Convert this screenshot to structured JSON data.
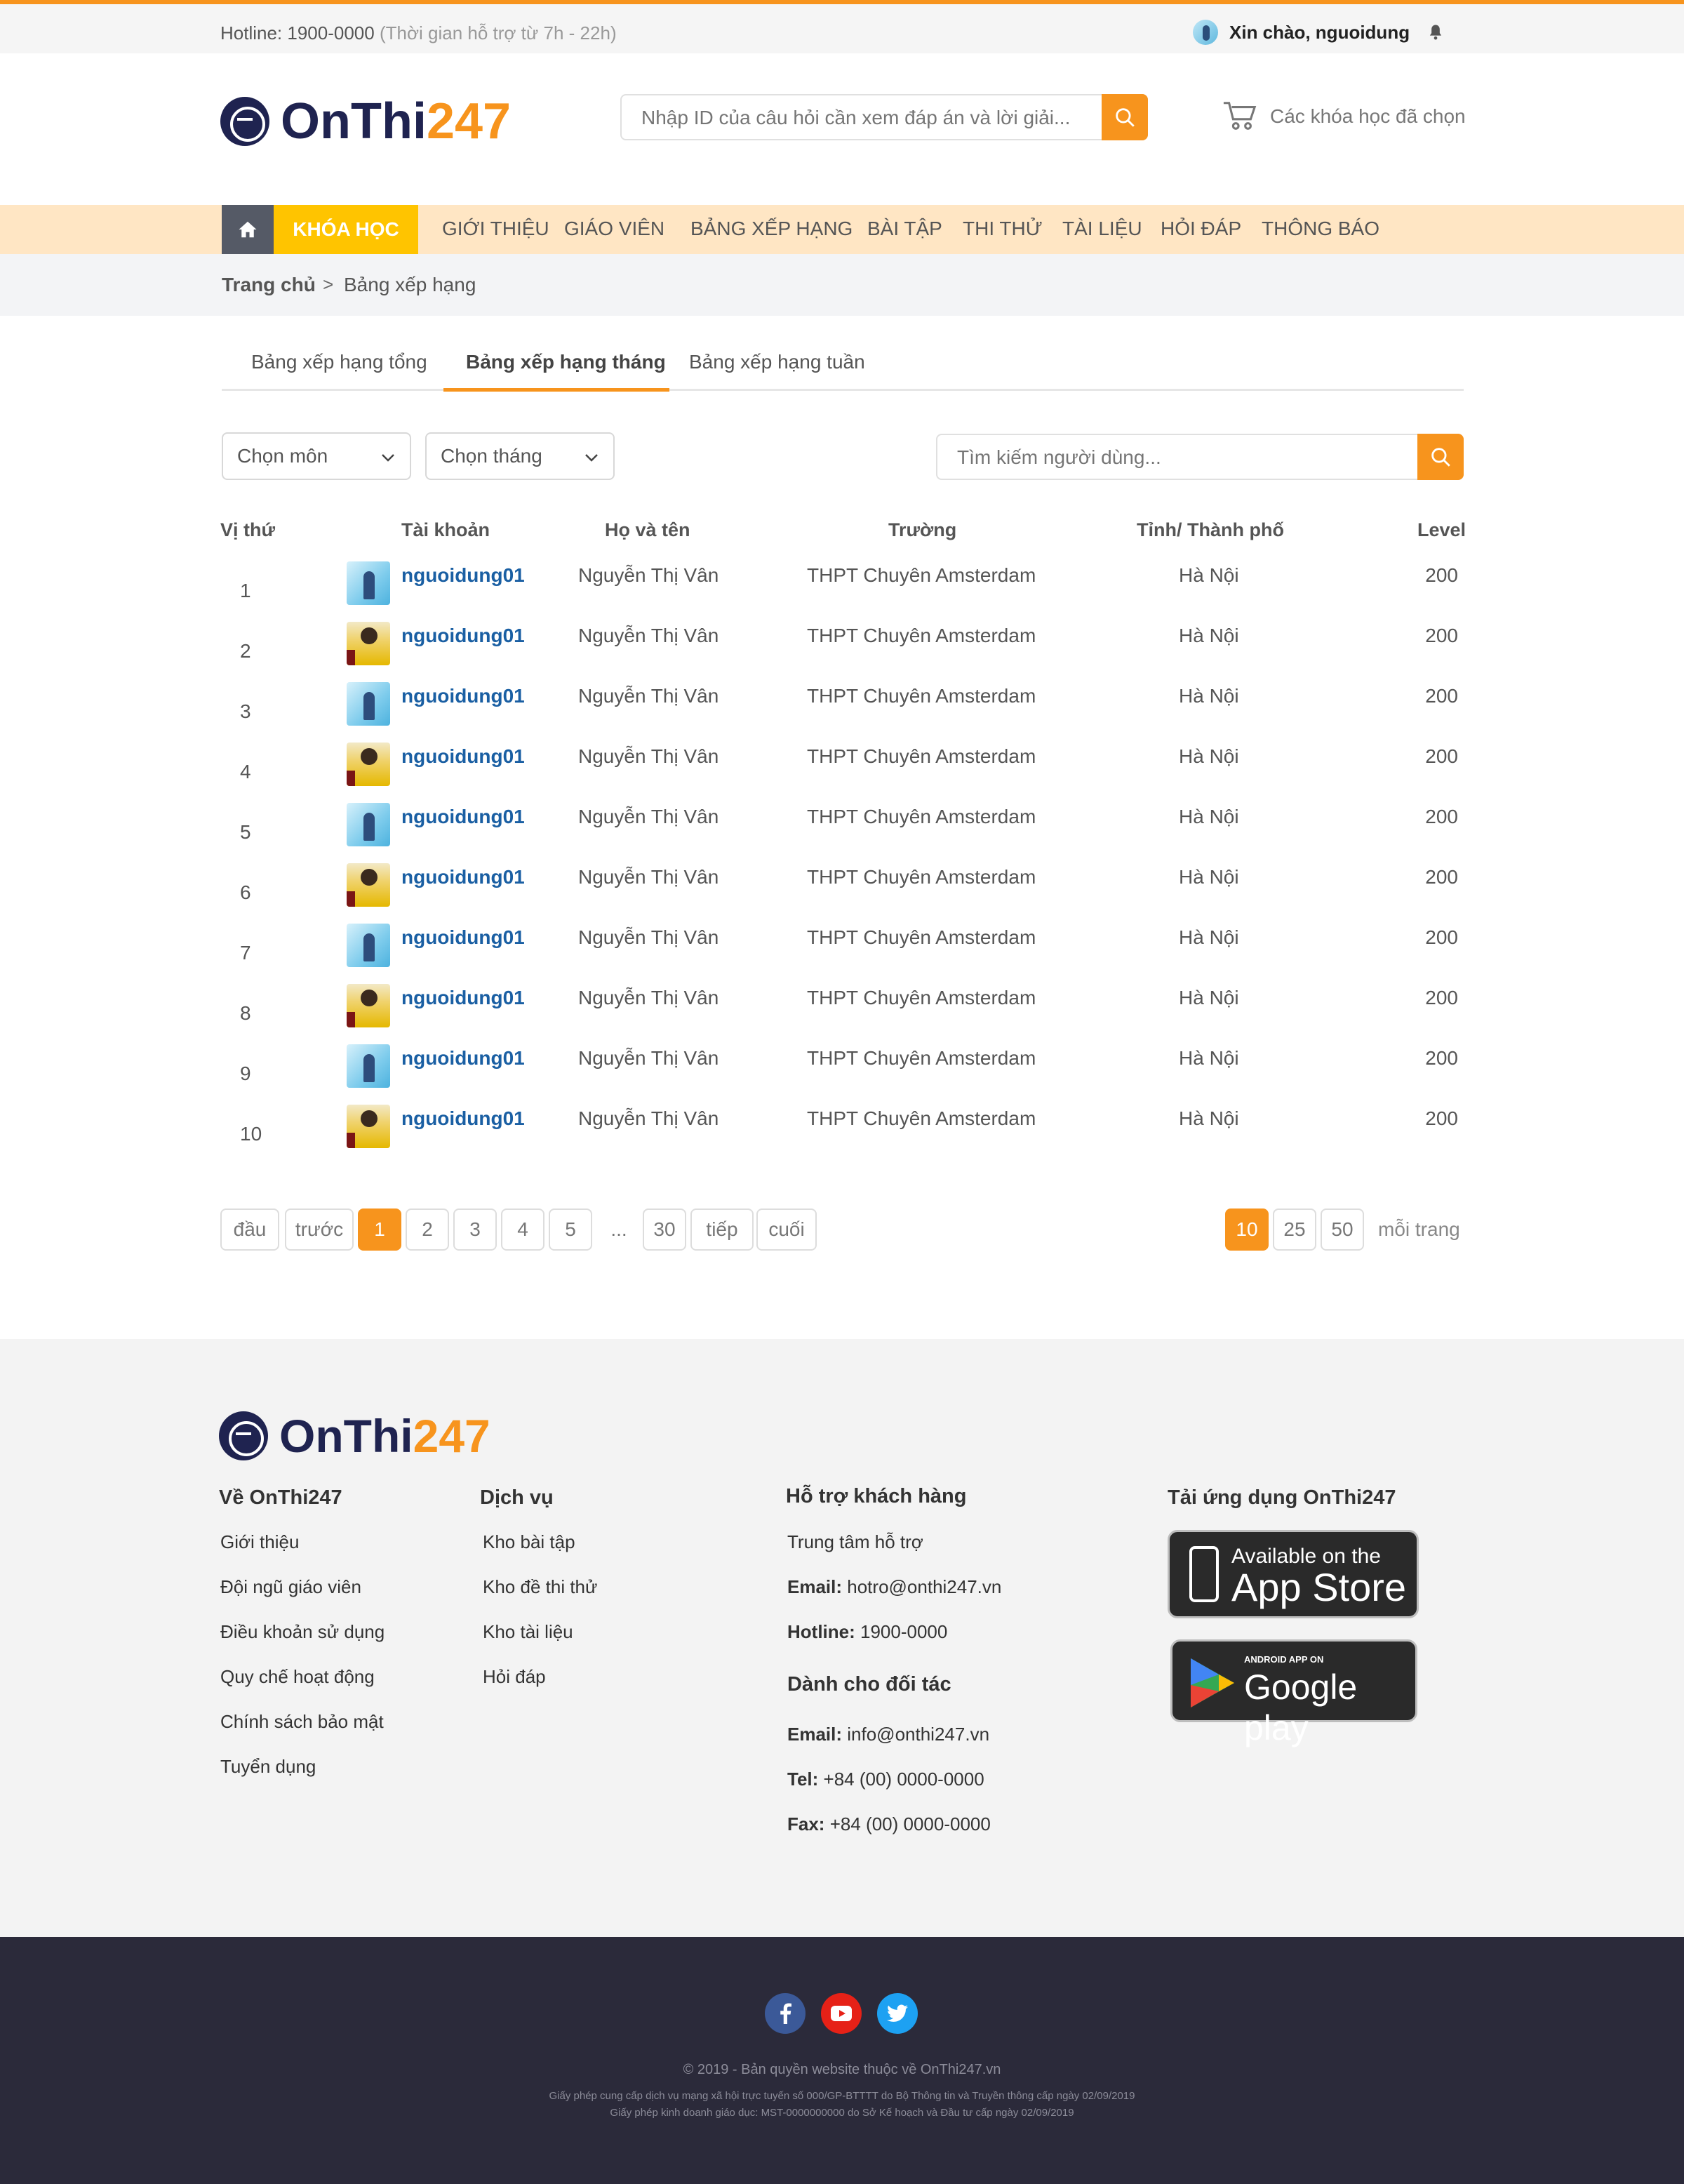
{
  "topbar": {
    "hotline_label": "Hotline: 1900-0000",
    "hotline_hours": "(Thời gian hỗ trợ từ 7h - 22h)",
    "greeting": "Xin chào, nguoidung"
  },
  "header": {
    "logo_part1": "OnThi",
    "logo_part2": "247",
    "search_placeholder": "Nhập ID của câu hỏi cần xem đáp án và lời giải...",
    "cart_label": "Các khóa học đã chọn"
  },
  "nav": {
    "course": "KHÓA HỌC",
    "items": [
      "GIỚI THIỆU",
      "GIÁO VIÊN",
      "BẢNG XẾP HẠNG",
      "BÀI TẬP",
      "THI THỬ",
      "TÀI LIỆU",
      "HỎI ĐÁP",
      "THÔNG BÁO"
    ]
  },
  "breadcrumb": {
    "home": "Trang chủ",
    "separator": ">",
    "current": "Bảng xếp hạng"
  },
  "tabs": [
    "Bảng xếp hạng tổng",
    "Bảng xếp hạng tháng",
    "Bảng xếp hạng tuần"
  ],
  "active_tab": 1,
  "filters": {
    "subject": "Chọn môn",
    "month": "Chọn tháng",
    "search_placeholder": "Tìm kiếm người dùng..."
  },
  "table": {
    "headers": {
      "rank": "Vị thứ",
      "account": "Tài khoản",
      "name": "Họ và tên",
      "school": "Trường",
      "city": "Tỉnh/ Thành phố",
      "level": "Level"
    },
    "rows": [
      {
        "rank": "1",
        "account": "nguoidung01",
        "name": "Nguyễn Thị Vân",
        "school": "THPT Chuyên Amsterdam",
        "city": "Hà Nội",
        "level": "200"
      },
      {
        "rank": "2",
        "account": "nguoidung01",
        "name": "Nguyễn Thị Vân",
        "school": "THPT Chuyên Amsterdam",
        "city": "Hà Nội",
        "level": "200"
      },
      {
        "rank": "3",
        "account": "nguoidung01",
        "name": "Nguyễn Thị Vân",
        "school": "THPT Chuyên Amsterdam",
        "city": "Hà Nội",
        "level": "200"
      },
      {
        "rank": "4",
        "account": "nguoidung01",
        "name": "Nguyễn Thị Vân",
        "school": "THPT Chuyên Amsterdam",
        "city": "Hà Nội",
        "level": "200"
      },
      {
        "rank": "5",
        "account": "nguoidung01",
        "name": "Nguyễn Thị Vân",
        "school": "THPT Chuyên Amsterdam",
        "city": "Hà Nội",
        "level": "200"
      },
      {
        "rank": "6",
        "account": "nguoidung01",
        "name": "Nguyễn Thị Vân",
        "school": "THPT Chuyên Amsterdam",
        "city": "Hà Nội",
        "level": "200"
      },
      {
        "rank": "7",
        "account": "nguoidung01",
        "name": "Nguyễn Thị Vân",
        "school": "THPT Chuyên Amsterdam",
        "city": "Hà Nội",
        "level": "200"
      },
      {
        "rank": "8",
        "account": "nguoidung01",
        "name": "Nguyễn Thị Vân",
        "school": "THPT Chuyên Amsterdam",
        "city": "Hà Nội",
        "level": "200"
      },
      {
        "rank": "9",
        "account": "nguoidung01",
        "name": "Nguyễn Thị Vân",
        "school": "THPT Chuyên Amsterdam",
        "city": "Hà Nội",
        "level": "200"
      },
      {
        "rank": "10",
        "account": "nguoidung01",
        "name": "Nguyễn Thị Vân",
        "school": "THPT Chuyên Amsterdam",
        "city": "Hà Nội",
        "level": "200"
      }
    ]
  },
  "pagination": {
    "first": "đầu",
    "prev": "trước",
    "pages": [
      "1",
      "2",
      "3",
      "4",
      "5"
    ],
    "ellipsis": "...",
    "last_page": "30",
    "next": "tiếp",
    "last": "cuối",
    "current_page": "1",
    "per_page_options": [
      "10",
      "25",
      "50"
    ],
    "per_page_selected": "10",
    "per_page_label": "mỗi trang"
  },
  "footer": {
    "about": {
      "title": "Về OnThi247",
      "links": [
        "Giới thiệu",
        "Đội ngũ giáo viên",
        "Điều khoản sử dụng",
        "Quy chế hoạt động",
        "Chính sách bảo mật",
        "Tuyển dụng"
      ]
    },
    "services": {
      "title": "Dịch vụ",
      "links": [
        "Kho bài tập",
        "Kho đề thi thử",
        "Kho tài liệu",
        "Hỏi đáp"
      ]
    },
    "support": {
      "title": "Hỗ trợ khách hàng",
      "center": "Trung tâm hỗ trợ",
      "email_label": "Email:",
      "email": "hotro@onthi247.vn",
      "hotline_label": "Hotline:",
      "hotline": "1900-0000"
    },
    "partners": {
      "title": "Dành cho đối tác",
      "email_label": "Email:",
      "email": "info@onthi247.vn",
      "tel_label": "Tel:",
      "tel": "+84 (00) 0000-0000",
      "fax_label": "Fax:",
      "fax": "+84 (00) 0000-0000"
    },
    "app": {
      "title": "Tải ứng dụng OnThi247",
      "appstore_line1": "Available on the",
      "appstore_line2": "App Store",
      "gplay_line1": "ANDROID APP ON",
      "gplay_line2": "Google play"
    }
  },
  "bottom": {
    "copyright": "© 2019 - Bản quyền website thuộc về OnThi247.vn",
    "license1": "Giấy phép cung cấp dịch vụ mạng xã hội trực tuyến số 000/GP-BTTTT do Bộ Thông tin và Truyền thông cấp ngày 02/09/2019",
    "license2": "Giấy phép kinh doanh giáo dục: MST-0000000000 do Sở Kế hoạch và Đầu tư cấp ngày 02/09/2019"
  },
  "colors": {
    "accent": "#f7941d",
    "nav_bg": "#ffe6c4",
    "course_btn": "#ffc400",
    "link_blue": "#1a5fa3",
    "bottom_bg": "#2b2a3a",
    "facebook": "#3b5998",
    "youtube": "#e62117",
    "twitter": "#1da1f2"
  },
  "icons": [
    "home-icon",
    "search-icon",
    "cart-icon",
    "bell-icon",
    "chevron-down-icon",
    "facebook-icon",
    "youtube-icon",
    "twitter-icon",
    "phone-icon",
    "play-triangle-icon"
  ]
}
